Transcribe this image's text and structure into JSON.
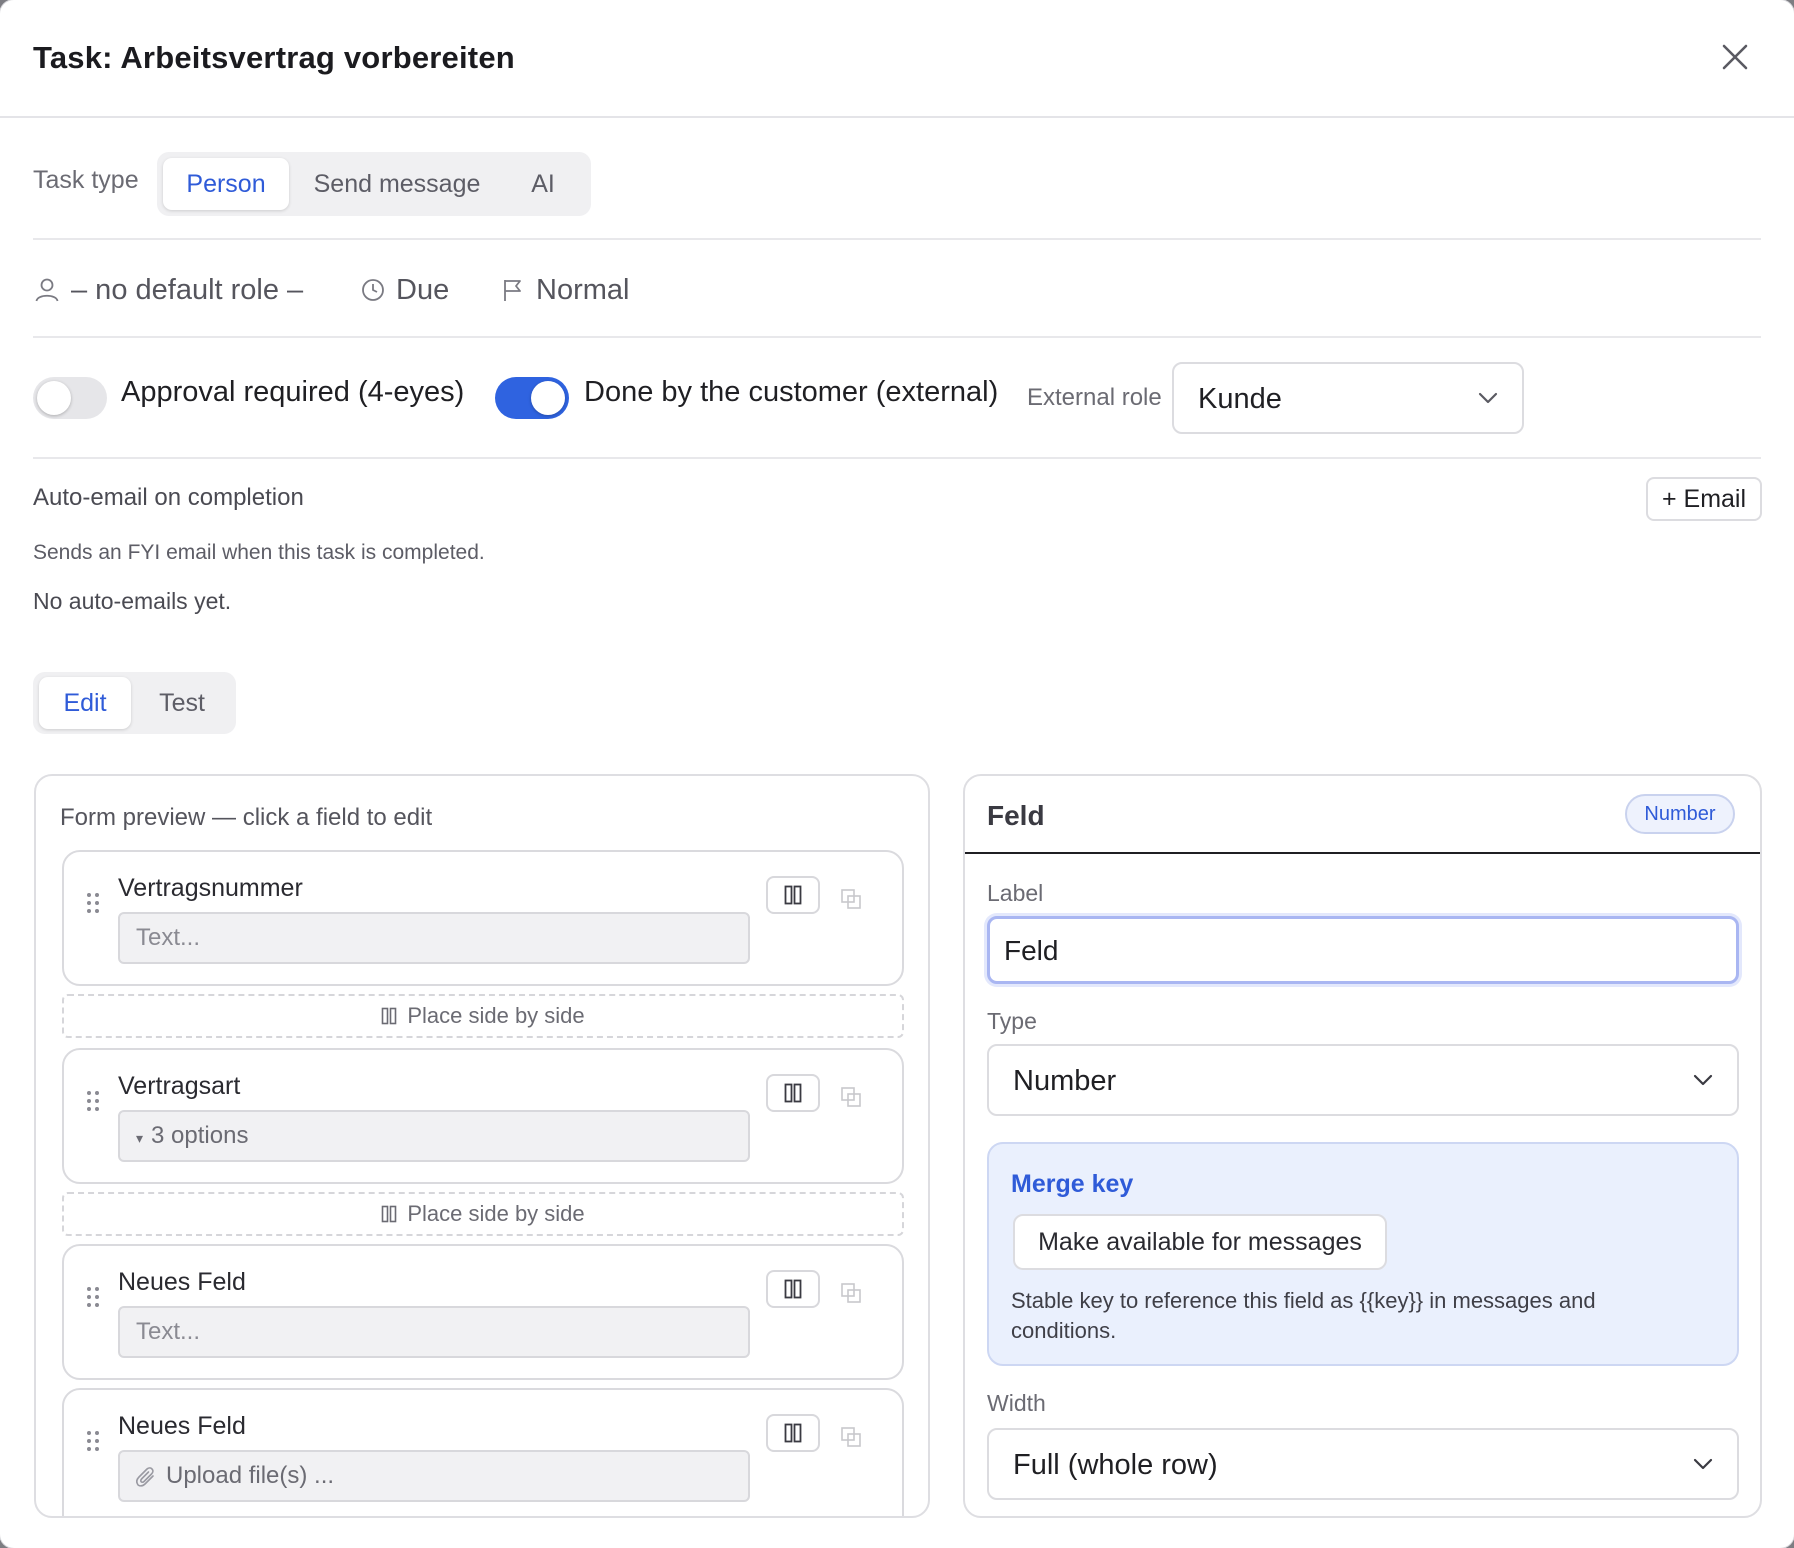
{
  "header": {
    "title": "Task: Arbeitsvertrag vorbereiten",
    "close_icon": "close-icon"
  },
  "task_type": {
    "label": "Task type",
    "options": [
      "Person",
      "Send message",
      "AI"
    ],
    "selected": "Person"
  },
  "meta": {
    "role": "– no default role –",
    "due": "Due",
    "priority": "Normal"
  },
  "toggles": {
    "approval": {
      "label": "Approval required (4-eyes)",
      "on": false
    },
    "external": {
      "label": "Done by the customer (external)",
      "on": true
    },
    "external_role_label": "External role",
    "external_role_value": "Kunde"
  },
  "auto_email": {
    "title": "Auto-email on completion",
    "description": "Sends an FYI email when this task is completed.",
    "empty": "No auto-emails yet.",
    "add_button": "+ Email"
  },
  "mode_tabs": {
    "options": [
      "Edit",
      "Test"
    ],
    "selected": "Edit"
  },
  "form_preview": {
    "title": "Form preview — click a field to edit",
    "place_side_by_side": "Place side by side",
    "fields": [
      {
        "label": "Vertragsnummer",
        "placeholder": "Text..."
      },
      {
        "label": "Vertragsart",
        "placeholder": "3 options",
        "prefix": "▾"
      },
      {
        "label": "Neues Feld",
        "placeholder": "Text..."
      },
      {
        "label": "Neues Feld",
        "placeholder": "Upload file(s) ..."
      }
    ]
  },
  "editor": {
    "title": "Feld",
    "badge": "Number",
    "label_caption": "Label",
    "label_value": "Feld",
    "type_caption": "Type",
    "type_value": "Number",
    "merge": {
      "title": "Merge key",
      "button": "Make available for messages",
      "help": "Stable key to reference this field as {{key}} in messages and conditions."
    },
    "width_caption": "Width",
    "width_value": "Full (whole row)"
  },
  "colors": {
    "accent": "#2f63e0",
    "link": "#2f5bd8",
    "merge_bg": "#eaf0fd",
    "focus_ring": "#a9b6f2"
  }
}
